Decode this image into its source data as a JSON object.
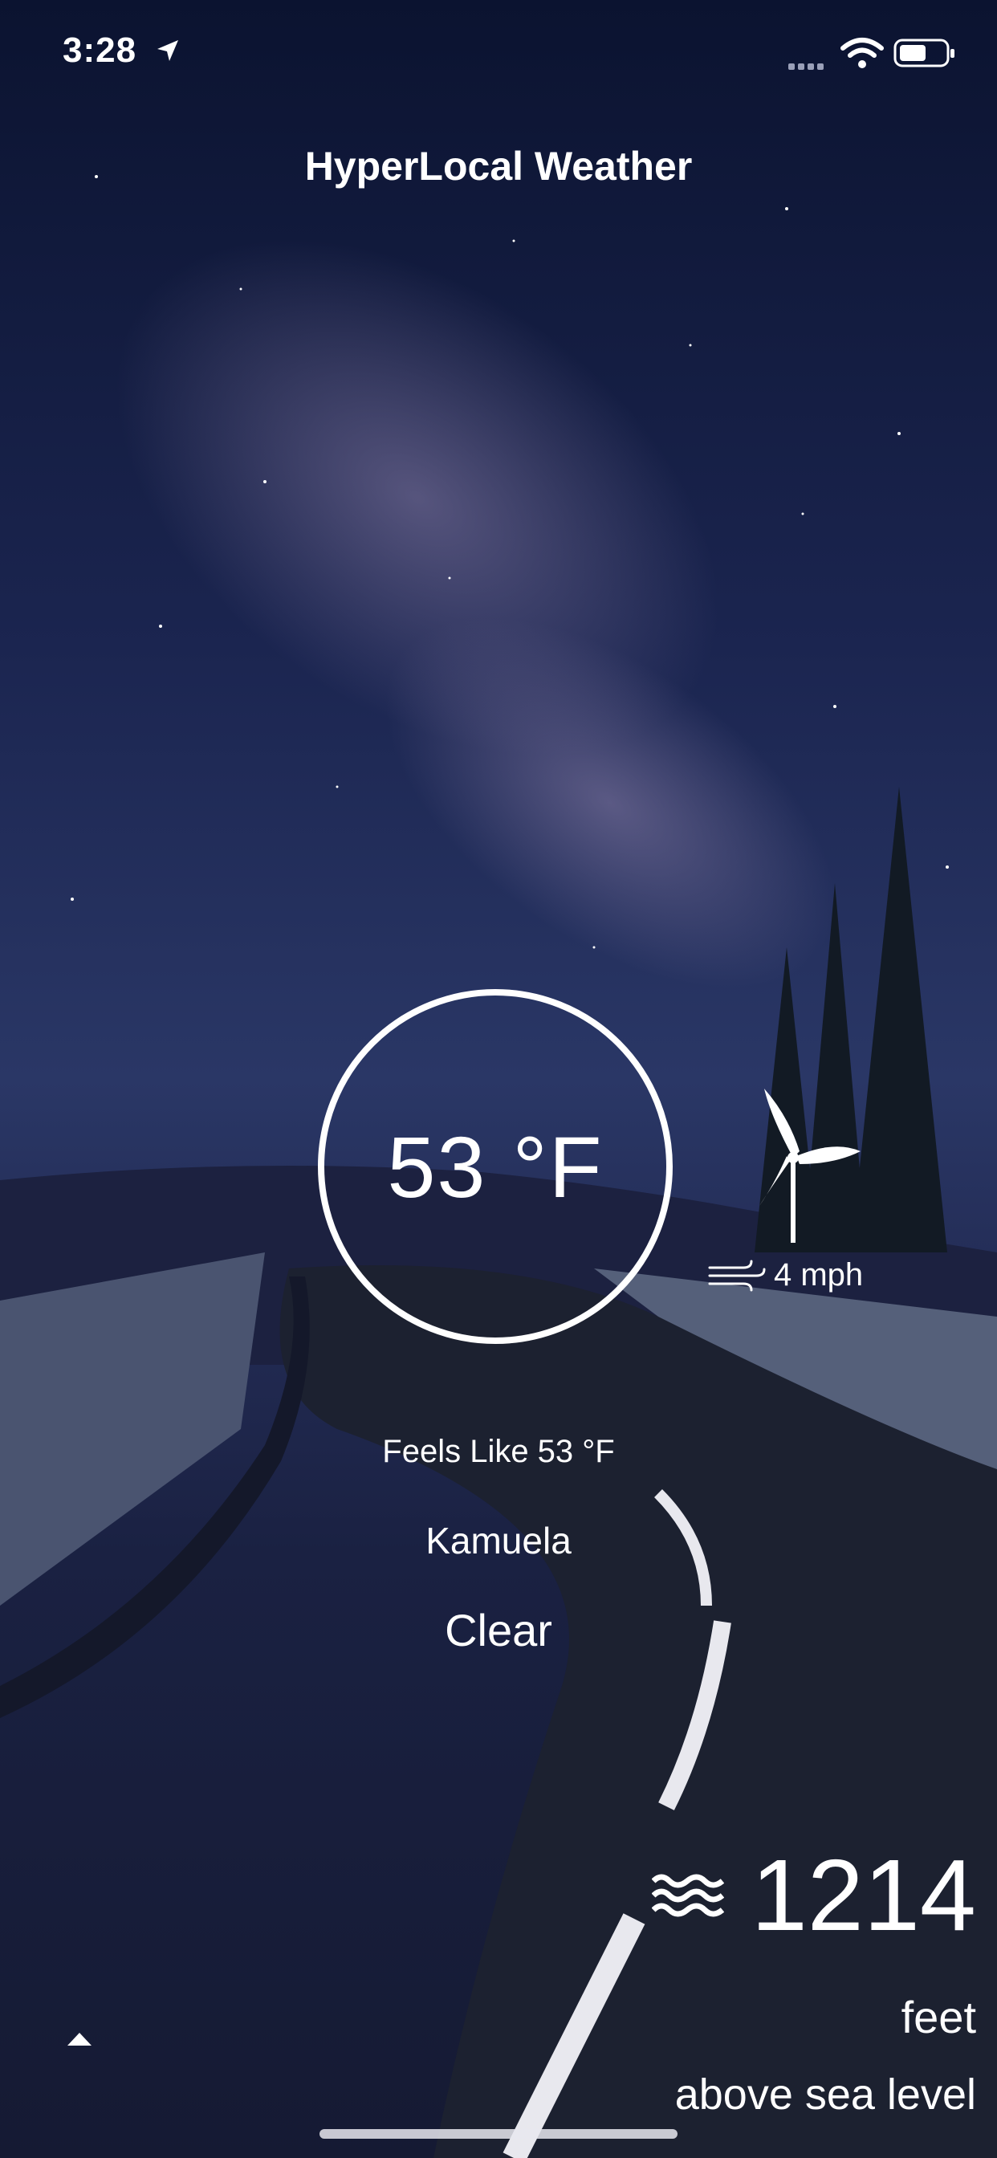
{
  "status_bar": {
    "time": "3:28"
  },
  "app": {
    "title": "HyperLocal Weather"
  },
  "current": {
    "temperature": "53 °F",
    "wind_speed": "4 mph",
    "feels_like": "Feels Like 53  °F",
    "location": "Kamuela",
    "condition": "Clear"
  },
  "elevation": {
    "value": "1214",
    "unit": "feet",
    "description": "above sea level"
  },
  "icons": [
    "location-arrow-icon",
    "signal-icon",
    "wifi-icon",
    "battery-icon",
    "wind-turbine-icon",
    "wind-icon",
    "water-waves-icon",
    "caret-up-icon"
  ]
}
